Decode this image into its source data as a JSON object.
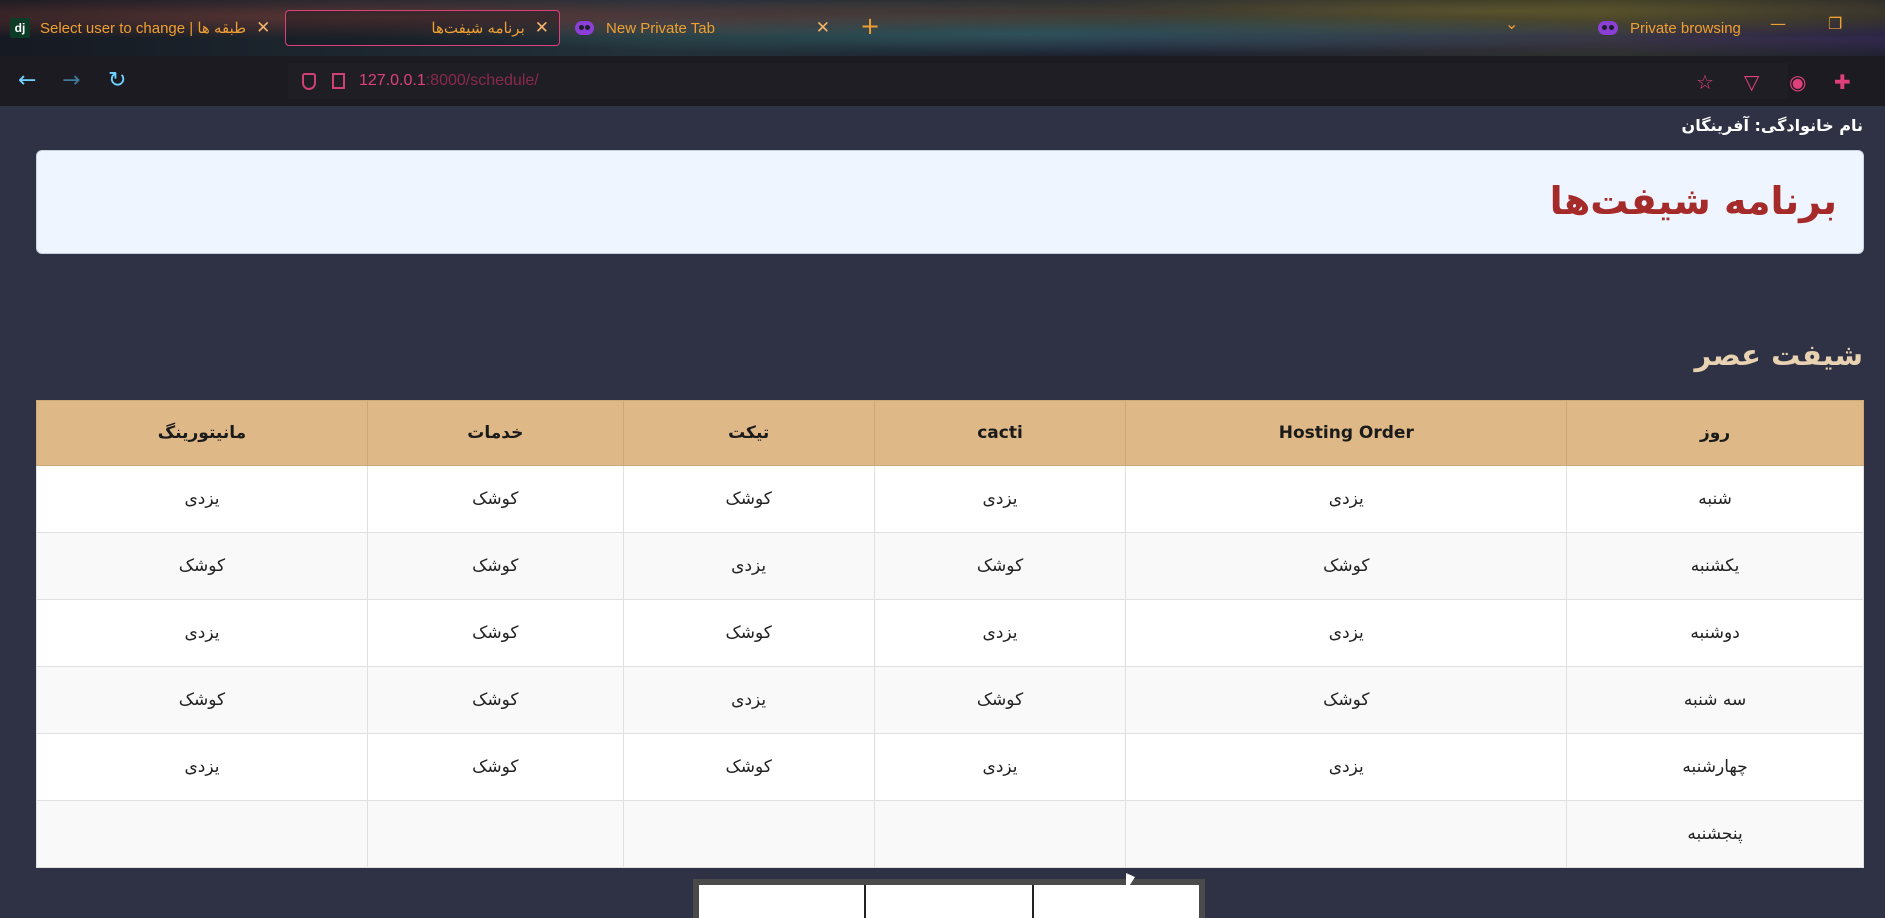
{
  "browser": {
    "tabs": [
      {
        "title": "Select user to change | طبقه ها",
        "icon": "django-icon"
      },
      {
        "title": "برنامه شیفت‌ها",
        "icon": "none",
        "active": true
      },
      {
        "title": "New Private Tab",
        "icon": "private-mask-icon"
      }
    ],
    "dj_label": "dj",
    "new_tab_symbol": "+",
    "close_symbol": "✕",
    "private_browsing_label": "Private browsing",
    "url_host": "127.0.0.1",
    "url_rest": ":8000/schedule/"
  },
  "page": {
    "family_line": "نام خانوادگی: آفرینگان",
    "title": "برنامه شیفت‌ها",
    "shift_heading": "شیفت عصر",
    "table": {
      "headers": [
        "روز",
        "Hosting Order",
        "cacti",
        "تیکت",
        "خدمات",
        "مانیتورینگ"
      ],
      "rows": [
        [
          "شنبه",
          "یزدی",
          "یزدی",
          "کوشک",
          "کوشک",
          "یزدی"
        ],
        [
          "یکشنبه",
          "کوشک",
          "کوشک",
          "یزدی",
          "کوشک",
          "کوشک"
        ],
        [
          "دوشنبه",
          "یزدی",
          "یزدی",
          "کوشک",
          "کوشک",
          "یزدی"
        ],
        [
          "سه شنبه",
          "کوشک",
          "کوشک",
          "یزدی",
          "کوشک",
          "کوشک"
        ],
        [
          "چهارشنبه",
          "یزدی",
          "یزدی",
          "کوشک",
          "کوشک",
          "یزدی"
        ],
        [
          "پنجشنبه",
          "",
          "",
          "",
          "",
          ""
        ]
      ]
    }
  },
  "colors": {
    "page_bg": "#2f3245",
    "title_red": "#a52a2a",
    "header_tan": "#deb887",
    "accent_pink": "#e0407a",
    "tab_text_orange": "#f0a030"
  }
}
